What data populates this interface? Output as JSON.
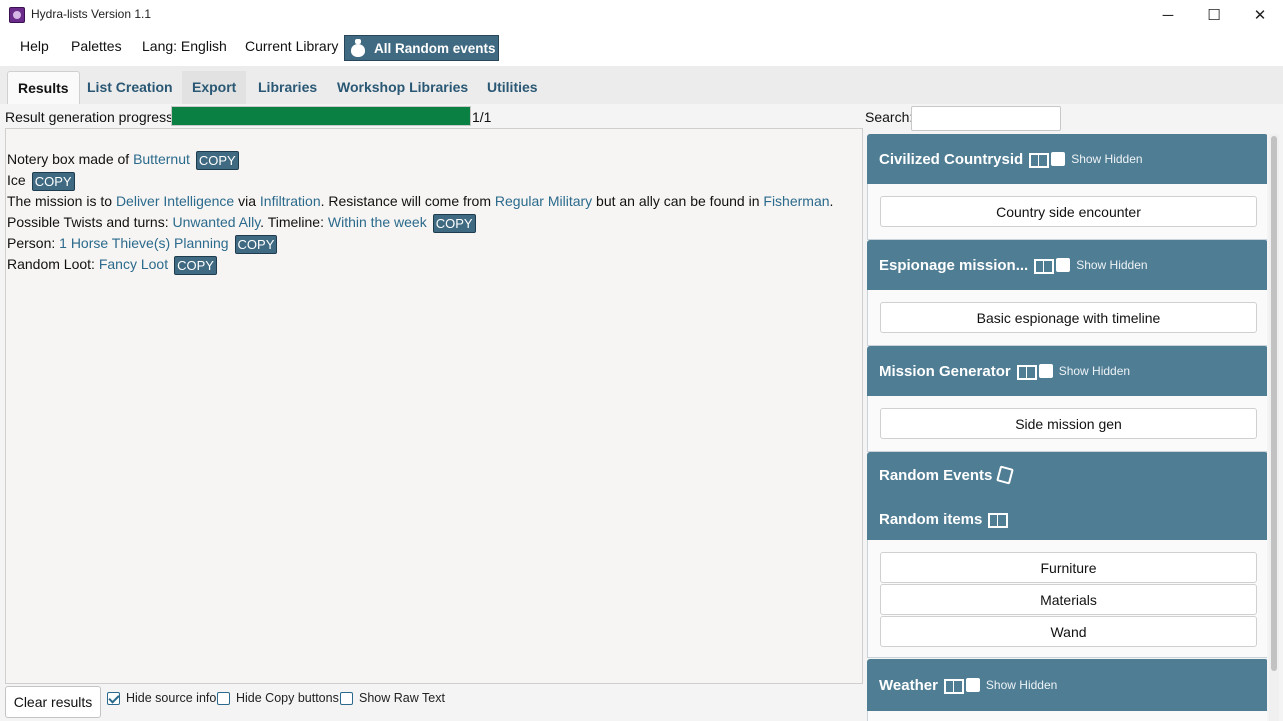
{
  "window": {
    "title": "Hydra-lists Version 1.1",
    "controls": {
      "minimize": "─",
      "maximize": "☐",
      "close": "✕"
    }
  },
  "menu": {
    "items": [
      "Help",
      "Palettes",
      "Lang: English",
      "Current Library"
    ],
    "library_button": "All Random events"
  },
  "tabs": [
    "Results",
    "List Creation",
    "Export",
    "Libraries",
    "Workshop Libraries",
    "Utilities"
  ],
  "active_tab": "Results",
  "progress": {
    "label": "Result generation progress",
    "count": "1/1",
    "fraction": 1.0
  },
  "results": {
    "copy_label": "COPY",
    "lines": [
      {
        "parts": [
          {
            "text": "Notery box made of "
          },
          {
            "text": "Butternut",
            "link": true
          }
        ],
        "copy": true
      },
      {
        "parts": [
          {
            "text": "Ice"
          }
        ],
        "copy": true
      },
      {
        "parts": [
          {
            "text": "The mission is to "
          },
          {
            "text": "Deliver Intelligence",
            "link": true
          },
          {
            "text": " via "
          },
          {
            "text": "Infiltration",
            "link": true
          },
          {
            "text": ". Resistance will come from "
          },
          {
            "text": "Regular Military",
            "link": true
          },
          {
            "text": " but an ally can be found in "
          },
          {
            "text": "Fisherman",
            "link": true
          },
          {
            "text": "."
          }
        ],
        "copy": false
      },
      {
        "parts": [
          {
            "text": "Possible Twists and turns: "
          },
          {
            "text": "Unwanted Ally",
            "link": true
          },
          {
            "text": ". Timeline: "
          },
          {
            "text": "Within the week",
            "link": true
          }
        ],
        "copy": true
      },
      {
        "parts": [
          {
            "text": "Person: "
          },
          {
            "text": "1 Horse Thieve(s) Planning",
            "link": true
          }
        ],
        "copy": true
      },
      {
        "parts": [
          {
            "text": "Random Loot: "
          },
          {
            "text": "Fancy Loot",
            "link": true
          }
        ],
        "copy": true
      }
    ]
  },
  "bottom": {
    "clear_label": "Clear results",
    "checkboxes": [
      {
        "label": "Hide source info",
        "checked": true
      },
      {
        "label": "Hide Copy buttons",
        "checked": false
      },
      {
        "label": "Show Raw Text",
        "checked": false
      }
    ]
  },
  "search": {
    "label": "Search:",
    "value": ""
  },
  "categories": [
    {
      "title": "Civilized Countrysid",
      "icon": "book-icon",
      "show_hidden": "Show Hidden",
      "lists": [
        "Country side encounter"
      ]
    },
    {
      "title": "Espionage mission...",
      "icon": "book-icon",
      "show_hidden": "Show Hidden",
      "lists": [
        "Basic espionage with timeline"
      ]
    },
    {
      "title": "Mission Generator",
      "icon": "book-icon",
      "show_hidden": "Show Hidden",
      "lists": [
        "Side mission gen"
      ]
    },
    {
      "title": "Random Events",
      "icon": "note-icon",
      "show_hidden": "",
      "lists": []
    },
    {
      "title": "Random items",
      "icon": "book-icon",
      "show_hidden": "",
      "lists": [
        "Furniture",
        "Materials",
        "Wand"
      ]
    },
    {
      "title": "Weather",
      "icon": "book-icon",
      "show_hidden": "Show Hidden",
      "lists": []
    }
  ],
  "colors": {
    "accent": "#3f6a82",
    "category_header": "#4f7d94",
    "progress_fill": "#0a8043",
    "link": "#2b6a8c"
  }
}
